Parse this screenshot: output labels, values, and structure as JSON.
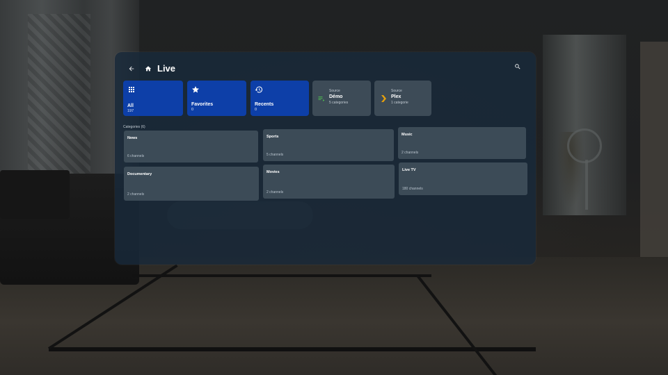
{
  "header": {
    "title": "Live"
  },
  "tiles": [
    {
      "label": "All",
      "count": "197",
      "icon": "grid-icon"
    },
    {
      "label": "Favorites",
      "count": "0",
      "icon": "star-icon"
    },
    {
      "label": "Recents",
      "count": "0",
      "icon": "history-icon"
    }
  ],
  "sources": [
    {
      "sublabel": "Source",
      "name": "Démo",
      "count": "5 categories",
      "icon": "playlist-icon",
      "accent": "#4caf50"
    },
    {
      "sublabel": "Source",
      "name": "Plex",
      "count": "1 categorie",
      "icon": "plex-chevron-icon",
      "accent": "#e5a00d"
    }
  ],
  "categories": {
    "label": "Categories (6)",
    "items": [
      {
        "name": "News",
        "count": "6 channels"
      },
      {
        "name": "Sports",
        "count": "5 channels"
      },
      {
        "name": "Music",
        "count": "2 channels"
      },
      {
        "name": "Documentary",
        "count": "2 channels"
      },
      {
        "name": "Movies",
        "count": "2 channels"
      },
      {
        "name": "Live TV",
        "count": "180 channels"
      }
    ]
  },
  "colors": {
    "tile_blue": "#0d3fa8",
    "panel": "#18293a",
    "card": "#3c4b57"
  }
}
